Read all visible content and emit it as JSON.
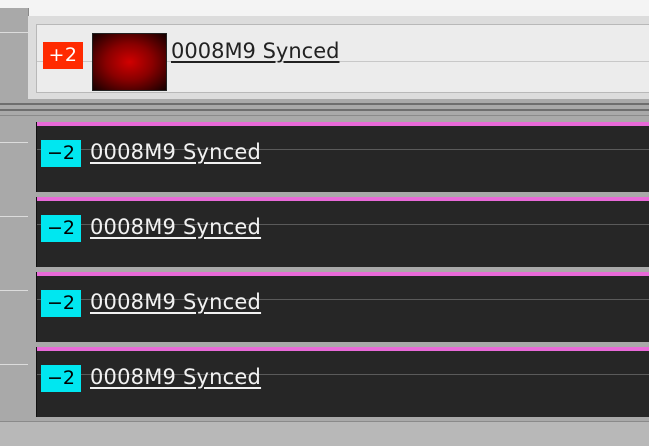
{
  "video_track": {
    "badge": "+2",
    "title": "0008M9 Synced",
    "thumbnail_text": "",
    "badge_color": "#ff2a00"
  },
  "audio_tracks": [
    {
      "badge": "−2",
      "title": "0008M9 Synced"
    },
    {
      "badge": "−2",
      "title": "0008M9 Synced"
    },
    {
      "badge": "−2",
      "title": "0008M9 Synced"
    },
    {
      "badge": "−2",
      "title": "0008M9 Synced"
    }
  ],
  "colors": {
    "audio_badge": "#00e7f0",
    "audio_waveform_top": "#e86ad8",
    "clip_background": "#262626"
  }
}
